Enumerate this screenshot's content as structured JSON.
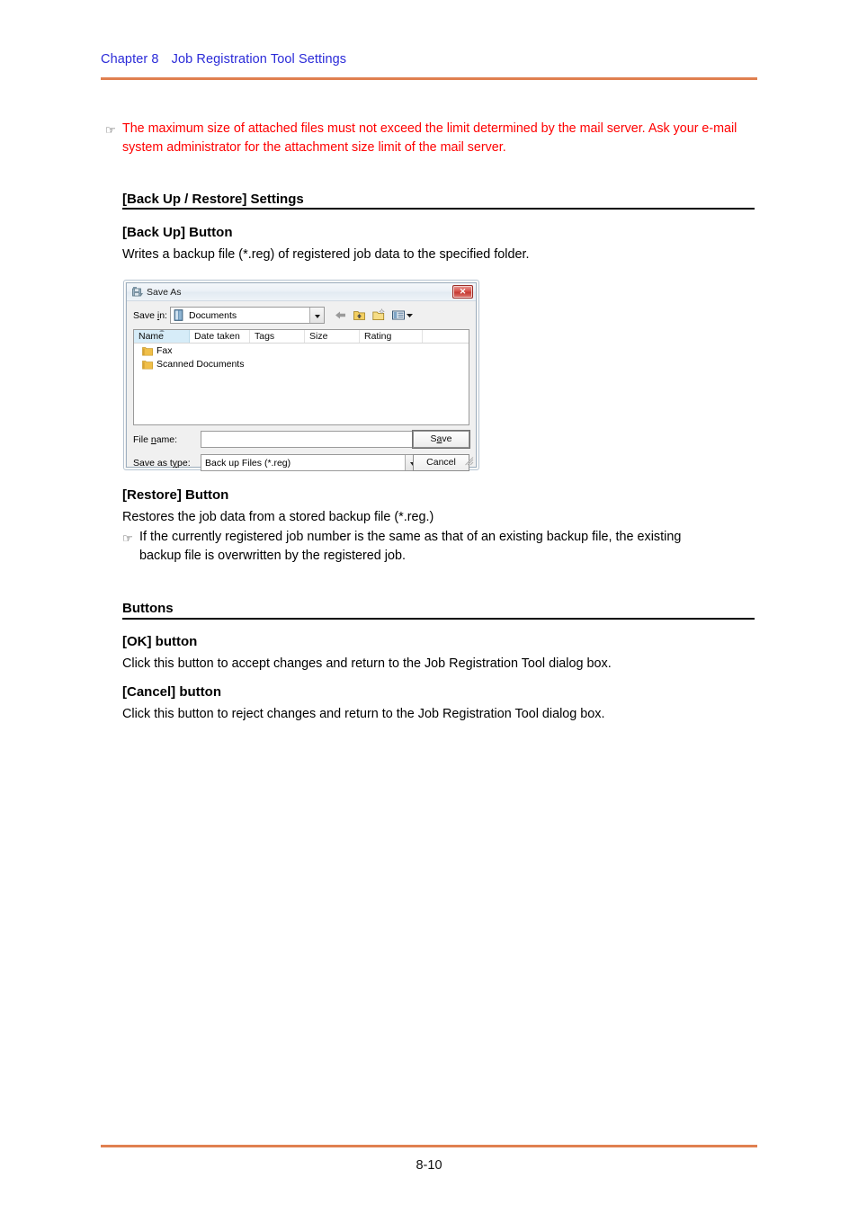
{
  "header": {
    "chapter": "Chapter 8",
    "title": "Job Registration Tool Settings"
  },
  "footer": {
    "page_number": "8-10"
  },
  "colors": {
    "header_text": "#2b2bd8",
    "rule_orange": "#e08050",
    "note_red": "#ff0000",
    "rule_black": "#000000"
  },
  "notes": {
    "mail_server": {
      "marker": "☞",
      "text": "The maximum size of attached files must not exceed the limit determined by the mail server. Ask your e-mail system administrator for the attachment size limit of the mail server."
    },
    "restore_overwrite": {
      "marker": "☞",
      "line1": "If the currently registered job number is the same as that of an existing backup file, the existing",
      "line2": "backup file is overwritten by the registered job."
    }
  },
  "sections": {
    "backup_restore": {
      "heading": "[Back Up / Restore] Settings",
      "backup_button": {
        "heading": "[Back Up] Button",
        "description": "Writes a backup file (*.reg) of registered job data to the specified folder."
      },
      "restore_button": {
        "heading": "[Restore] Button",
        "description": "Restores the job data from a stored backup file (*.reg.)"
      }
    },
    "buttons": {
      "heading": "Buttons",
      "ok_button": {
        "heading": "[OK] button",
        "description": "Click this button to accept changes and return to the Job Registration Tool dialog box."
      },
      "cancel_button": {
        "heading": "[Cancel] button",
        "description": "Click this button to reject changes and return to the Job Registration Tool dialog box."
      }
    }
  },
  "save_as_dialog": {
    "title": "Save As",
    "title_icon": "save-as-icon",
    "close_label": "✕",
    "save_in": {
      "label_pre": "Save ",
      "label_accel": "i",
      "label_post": "n:",
      "value": "Documents",
      "icon": "documents-folder-icon"
    },
    "toolbar": [
      {
        "name": "back-icon",
        "label": "Back"
      },
      {
        "name": "up-one-level-icon",
        "label": "Up One Level"
      },
      {
        "name": "new-folder-icon",
        "label": "Create New Folder"
      },
      {
        "name": "views-icon",
        "label": "Views"
      }
    ],
    "columns": [
      {
        "label": "Name",
        "sorted": true
      },
      {
        "label": "Date taken",
        "sorted": false
      },
      {
        "label": "Tags",
        "sorted": false
      },
      {
        "label": "Size",
        "sorted": false
      },
      {
        "label": "Rating",
        "sorted": false
      },
      {
        "label": "",
        "sorted": false
      }
    ],
    "items": [
      {
        "name": "Fax",
        "icon": "folder-icon"
      },
      {
        "name": "Scanned Documents",
        "icon": "folder-icon"
      }
    ],
    "file_name": {
      "label_pre": "File ",
      "label_accel": "n",
      "label_post": "ame:",
      "value": ""
    },
    "save_as_type": {
      "label_pre": "Save as t",
      "label_accel": "y",
      "label_post": "pe:",
      "value": "Back up Files (*.reg)"
    },
    "buttons": {
      "save": {
        "pre": "S",
        "accel": "a",
        "post": "ve"
      },
      "cancel": {
        "label": "Cancel"
      }
    }
  }
}
